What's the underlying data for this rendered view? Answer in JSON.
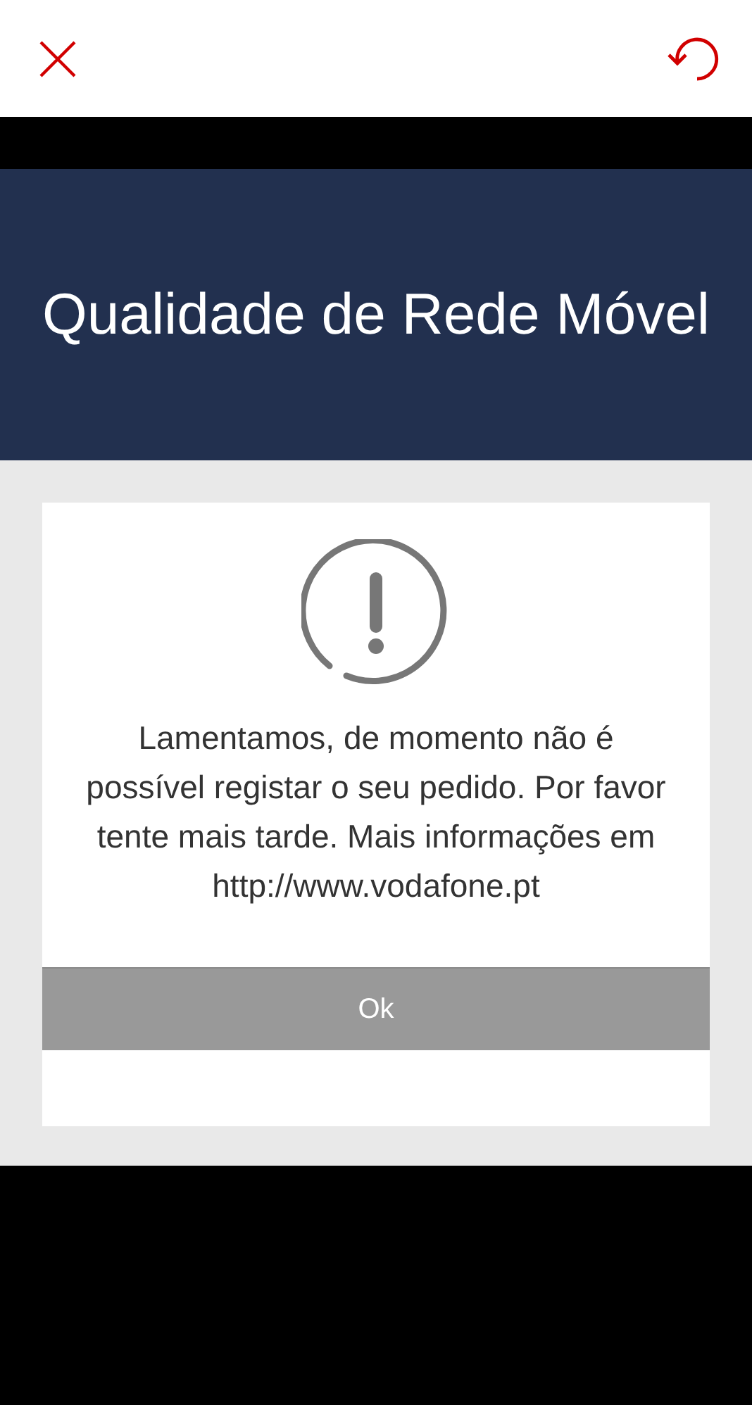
{
  "header": {
    "title": "Qualidade de Rede Móvel"
  },
  "dialog": {
    "message": "Lamentamos, de momento não é possível registar o seu pedido. Por favor tente mais tarde. Mais informações em http://www.vodafone.pt",
    "button": "Ok"
  }
}
